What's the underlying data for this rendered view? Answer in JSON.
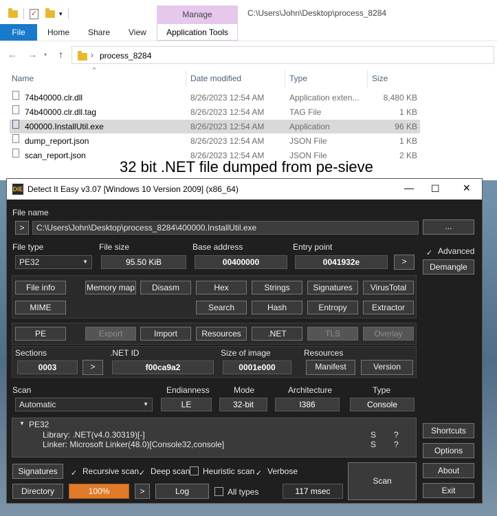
{
  "explorer": {
    "title_path": "C:\\Users\\John\\Desktop\\process_8284",
    "ribbon": {
      "tabs": [
        "File",
        "Home",
        "Share",
        "View"
      ],
      "context_group": "Manage",
      "context_tab": "Application Tools"
    },
    "address": {
      "folder": "process_8284"
    },
    "columns": {
      "name": "Name",
      "date": "Date modified",
      "type": "Type",
      "size": "Size"
    },
    "files": [
      {
        "name": "74b40000.clr.dll",
        "date": "8/26/2023 12:54 AM",
        "type": "Application exten...",
        "size": "8,480 KB",
        "icon": "dll-file-icon"
      },
      {
        "name": "74b40000.clr.dll.tag",
        "date": "8/26/2023 12:54 AM",
        "type": "TAG File",
        "size": "1 KB",
        "icon": "tag-file-icon"
      },
      {
        "name": "400000.InstallUtil.exe",
        "date": "8/26/2023 12:54 AM",
        "type": "Application",
        "size": "96 KB",
        "icon": "exe-file-icon",
        "selected": true
      },
      {
        "name": "dump_report.json",
        "date": "8/26/2023 12:54 AM",
        "type": "JSON File",
        "size": "1 KB",
        "icon": "json-file-icon"
      },
      {
        "name": "scan_report.json",
        "date": "8/26/2023 12:54 AM",
        "type": "JSON File",
        "size": "2 KB",
        "icon": "json-file-icon"
      }
    ]
  },
  "caption": "32 bit .NET file dumped from pe-sieve",
  "die": {
    "title": "Detect It Easy v3.07 [Windows 10 Version 2009] (x86_64)",
    "logo": "DIE",
    "file_name_label": "File name",
    "file_path": "C:\\Users\\John\\Desktop\\process_8284\\400000.InstallUtil.exe",
    "browse_label": "...",
    "arrow": ">",
    "labels": {
      "file_type": "File type",
      "file_size": "File size",
      "base_address": "Base address",
      "entry_point": "Entry point",
      "sections": "Sections",
      "net_id": ".NET ID",
      "size_of_image": "Size of image",
      "resources": "Resources",
      "scan": "Scan",
      "endianness": "Endianness",
      "mode": "Mode",
      "architecture": "Architecture",
      "type": "Type"
    },
    "values": {
      "file_type": "PE32",
      "file_size": "95.50 KiB",
      "base_address": "00400000",
      "entry_point": "0041932e",
      "sections": "0003",
      "net_id": "f00ca9a2",
      "size_of_image": "0001e000",
      "scan": "Automatic",
      "endianness": "LE",
      "mode": "32-bit",
      "architecture": "I386",
      "type": "Console"
    },
    "advanced_label": "Advanced",
    "demangle_label": "Demangle",
    "tools_row1": [
      "File info",
      "Memory map",
      "Disasm",
      "Hex",
      "Strings",
      "Signatures",
      "VirusTotal"
    ],
    "tools_row2": [
      "MIME",
      "Search",
      "Hash",
      "Entropy",
      "Extractor"
    ],
    "pe_row": [
      "PE",
      "Export",
      "Import",
      "Resources",
      ".NET",
      "TLS",
      "Overlay"
    ],
    "resource_buttons": [
      "Manifest",
      "Version"
    ],
    "result": {
      "root": "PE32",
      "lines": [
        {
          "text": "Library: .NET(v4.0.30319)[-]",
          "s": "S",
          "q": "?"
        },
        {
          "text": "Linker: Microsoft Linker(48.0)[Console32,console]",
          "s": "S",
          "q": "?"
        }
      ]
    },
    "side_buttons": [
      "Shortcuts",
      "Options",
      "About",
      "Exit"
    ],
    "bottom": {
      "signatures": "Signatures",
      "recursive_scan": "Recursive scan",
      "deep_scan": "Deep scan",
      "heuristic_scan": "Heuristic scan",
      "verbose": "Verbose",
      "directory": "Directory",
      "progress": "100%",
      "log": "Log",
      "all_types": "All types",
      "time": "117 msec",
      "scan": "Scan"
    },
    "accent_color": "#e07b2a"
  }
}
